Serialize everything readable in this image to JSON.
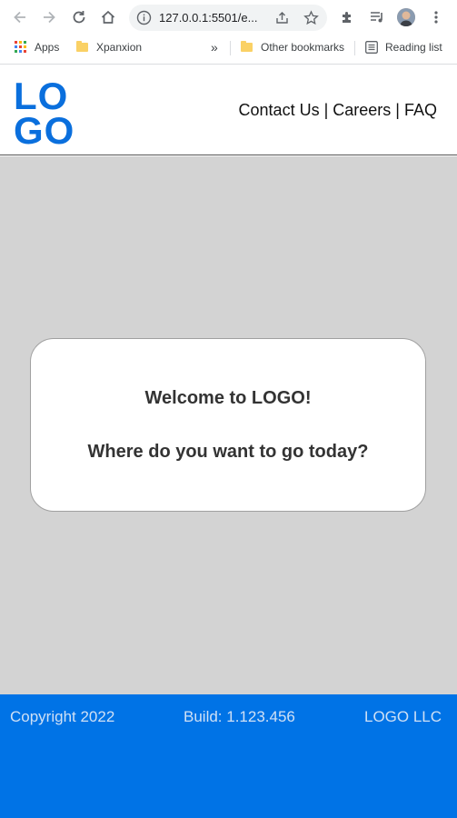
{
  "browser": {
    "url": "127.0.0.1:5501/e...",
    "icons": [
      "back-arrow-icon",
      "forward-arrow-icon",
      "reload-icon",
      "home-icon",
      "info-icon",
      "share-icon",
      "star-icon",
      "extensions-puzzle-icon",
      "reading-queue-icon",
      "profile-avatar",
      "kebab-menu-icon"
    ]
  },
  "bookmarks": {
    "apps": "Apps",
    "xpanxion": "Xpanxion",
    "overflow": "»",
    "other": "Other bookmarks",
    "reading_list": "Reading list"
  },
  "header": {
    "logo_line1": "LO",
    "logo_line2": "GO",
    "nav": {
      "contact": "Contact Us",
      "careers": "Careers",
      "faq": "FAQ",
      "separator": "|"
    }
  },
  "card": {
    "welcome": "Welcome to LOGO!",
    "question": "Where do you want to go today?"
  },
  "footer": {
    "copyright": "Copyright 2022",
    "build": "Build: 1.123.456",
    "company": "LOGO LLC"
  },
  "colors": {
    "brand_blue": "#0073e6",
    "logo_blue": "#0a6fdd",
    "main_bg": "#d3d3d3"
  }
}
